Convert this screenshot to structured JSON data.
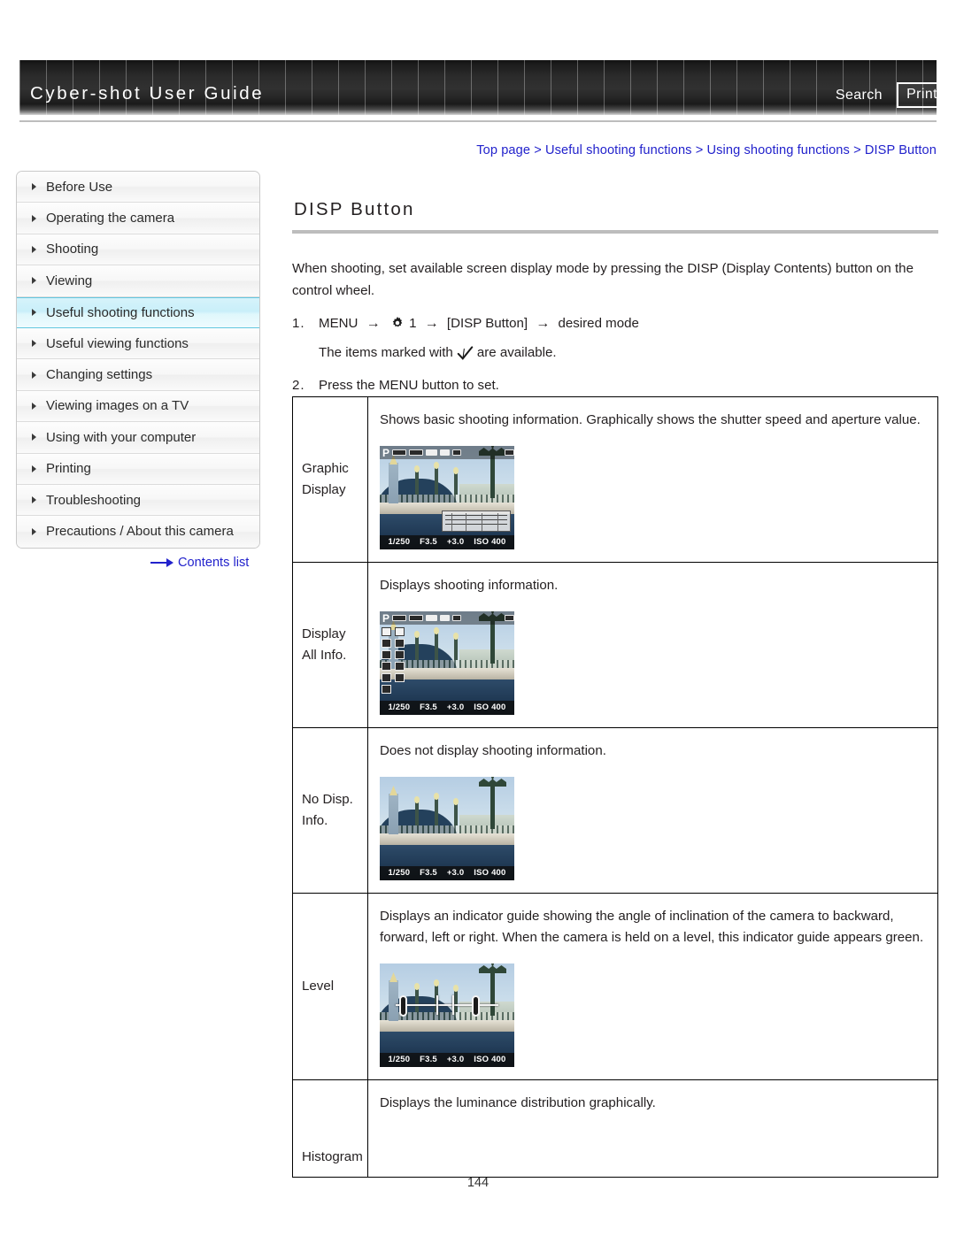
{
  "header": {
    "site_title": "Cyber-shot User Guide",
    "search_label": "Search",
    "print_label": "Print"
  },
  "breadcrumb": {
    "items": [
      "Top page",
      "Useful shooting functions",
      "Using shooting functions",
      "DISP Button"
    ],
    "separator": ">",
    "full_text": "Top page > Useful shooting functions > Using shooting functions > DISP Button",
    "link_color": "#2222cc"
  },
  "sidebar": {
    "items": [
      {
        "label": "Before Use",
        "active": false
      },
      {
        "label": "Operating the camera",
        "active": false
      },
      {
        "label": "Shooting",
        "active": false
      },
      {
        "label": "Viewing",
        "active": false
      },
      {
        "label": "Useful shooting functions",
        "active": true
      },
      {
        "label": "Useful viewing functions",
        "active": false
      },
      {
        "label": "Changing settings",
        "active": false
      },
      {
        "label": "Viewing images on a TV",
        "active": false
      },
      {
        "label": "Using with your computer",
        "active": false
      },
      {
        "label": "Printing",
        "active": false
      },
      {
        "label": "Troubleshooting",
        "active": false
      },
      {
        "label": "Precautions / About this camera",
        "active": false
      }
    ],
    "active_highlight_color": "#c9eff9",
    "contents_list_label": "Contents list"
  },
  "main": {
    "title": "DISP Button",
    "intro": "When shooting, set available screen display mode by pressing the DISP (Display Contents) button on the control wheel.",
    "steps": [
      {
        "number": "1.",
        "parts": [
          "MENU",
          "1",
          "[DISP Button]",
          "desired mode"
        ],
        "arrow": "→",
        "sub_prefix": "The items marked with",
        "sub_suffix": "are available."
      },
      {
        "number": "2.",
        "text": "Press the MENU button to set."
      }
    ]
  },
  "table": {
    "rows": [
      {
        "mode": "Graphic Display",
        "mode_lines": [
          "Graphic",
          "Display"
        ],
        "description": "Shows basic shooting information. Graphically shows the shutter speed and aperture value.",
        "has_screenshot": true,
        "screenshot_overlay": {
          "mode_letter": "P",
          "shutter": "1/250",
          "aperture": "F3.5",
          "exposure": "+3.0",
          "iso": "ISO 400"
        }
      },
      {
        "mode": "Display All Info.",
        "mode_lines": [
          "Display",
          "All Info."
        ],
        "description": "Displays shooting information.",
        "has_screenshot": true,
        "screenshot_overlay": {
          "mode_letter": "P",
          "shutter": "1/250",
          "aperture": "F3.5",
          "exposure": "+3.0",
          "iso": "ISO 400"
        }
      },
      {
        "mode": "No Disp. Info.",
        "mode_lines": [
          "No Disp.",
          "Info."
        ],
        "description": "Does not display shooting information.",
        "has_screenshot": true,
        "screenshot_overlay": {
          "mode_letter": "",
          "shutter": "1/250",
          "aperture": "F3.5",
          "exposure": "+3.0",
          "iso": "ISO 400"
        }
      },
      {
        "mode": "Level",
        "mode_lines": [
          "Level"
        ],
        "description": "Displays an indicator guide showing the angle of inclination of the camera to backward, forward, left or right. When the camera is held on a level, this indicator guide appears green.",
        "has_screenshot": true,
        "screenshot_overlay": {
          "mode_letter": "",
          "shutter": "1/250",
          "aperture": "F3.5",
          "exposure": "+3.0",
          "iso": "ISO 400"
        }
      },
      {
        "mode": "Histogram",
        "mode_lines": [
          "Histogram"
        ],
        "description": "Displays the luminance distribution graphically.",
        "has_screenshot": false
      }
    ]
  },
  "footer": {
    "page_number": "144"
  }
}
